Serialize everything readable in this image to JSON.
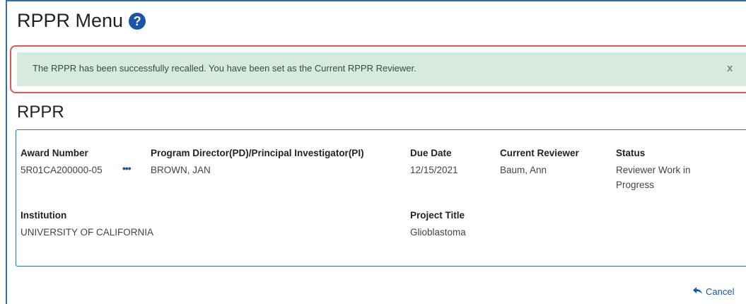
{
  "header": {
    "title": "RPPR Menu",
    "help_icon": "question-circle-icon"
  },
  "alert": {
    "message": "The RPPR has been successfully recalled. You have been set as the Current RPPR Reviewer.",
    "close_label": "x"
  },
  "section": {
    "title": "RPPR"
  },
  "award": {
    "number_label": "Award Number",
    "number_value": "5R01CA200000-05",
    "more_icon": "ellipsis-icon",
    "more_label": "•••",
    "pd_label": "Program Director(PD)/Principal Investigator(PI)",
    "pd_value": "BROWN, JAN",
    "due_label": "Due Date",
    "due_value": "12/15/2021",
    "reviewer_label": "Current Reviewer",
    "reviewer_value": "Baum, Ann",
    "status_label": "Status",
    "status_line1": "Reviewer Work in",
    "status_line2": "Progress",
    "institution_label": "Institution",
    "institution_value": "UNIVERSITY OF CALIFORNIA",
    "project_label": "Project Title",
    "project_value": "Glioblastoma"
  },
  "footer": {
    "cancel_label": "Cancel",
    "cancel_icon": "reply-arrow-icon"
  },
  "colors": {
    "accent": "#1a56a6",
    "alert_bg": "#d6ebdd",
    "alert_outline": "#e0575a",
    "frame": "#2f6fb0"
  }
}
